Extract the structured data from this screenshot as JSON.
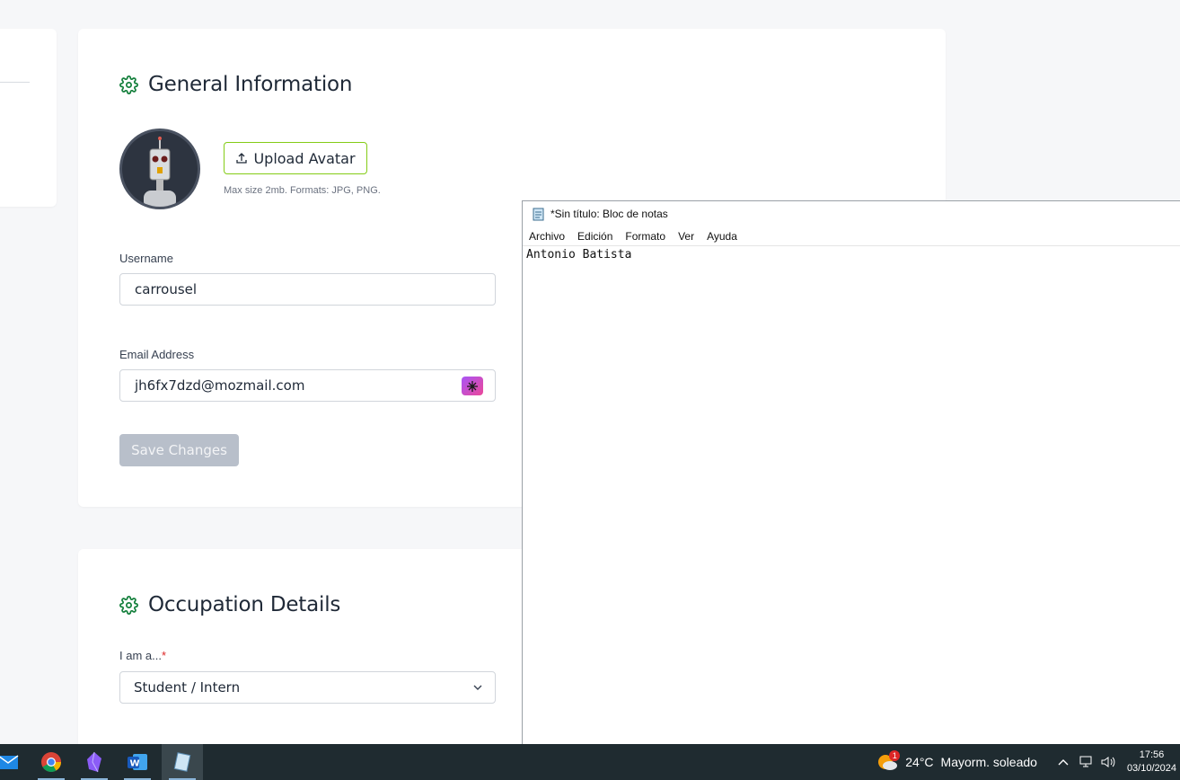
{
  "general": {
    "title": "General Information",
    "upload_label": "Upload Avatar",
    "upload_hint": "Max size 2mb. Formats: JPG, PNG.",
    "username_label": "Username",
    "username_value": "carrousel",
    "email_label": "Email Address",
    "email_value": "jh6fx7dzd@mozmail.com",
    "save_label": "Save Changes"
  },
  "occupation": {
    "title": "Occupation Details",
    "role_label": "I am a...",
    "role_required": "*",
    "role_value": "Student / Intern"
  },
  "notepad": {
    "title": "*Sin título: Bloc de notas",
    "menu": [
      "Archivo",
      "Edición",
      "Formato",
      "Ver",
      "Ayuda"
    ],
    "content": "Antonio Batista"
  },
  "taskbar": {
    "weather_badge": "1",
    "temperature": "24°C",
    "weather_text": "Mayorm. soleado",
    "time": "17:56",
    "date": "03/10/2024"
  },
  "colors": {
    "accent_green": "#84cc16",
    "gear_green": "#15803d",
    "disabled_button": "#b8bfca"
  }
}
